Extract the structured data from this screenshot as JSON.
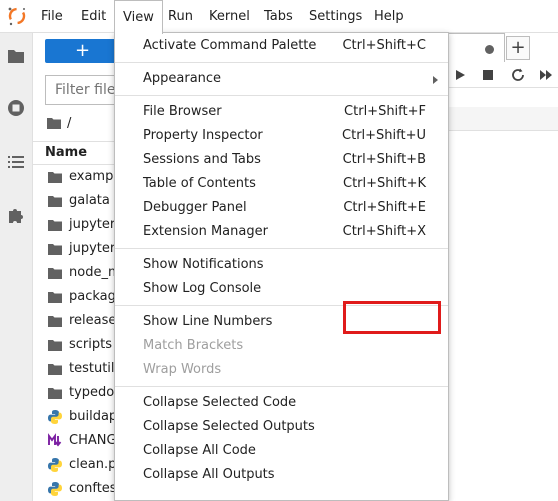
{
  "menubar": {
    "items": [
      "File",
      "Edit",
      "View",
      "Run",
      "Kernel",
      "Tabs",
      "Settings",
      "Help"
    ],
    "active": "View"
  },
  "filebrowser": {
    "new_button_label": "+",
    "filter_placeholder": "Filter files",
    "breadcrumb": "/",
    "column_name": "Name",
    "files": [
      {
        "name": "examples",
        "icon": "folder-icon"
      },
      {
        "name": "galata",
        "icon": "folder-icon"
      },
      {
        "name": "jupyter-",
        "icon": "folder-icon"
      },
      {
        "name": "jupyterl",
        "icon": "folder-icon"
      },
      {
        "name": "node_m",
        "icon": "folder-icon"
      },
      {
        "name": "package",
        "icon": "folder-icon"
      },
      {
        "name": "release",
        "icon": "folder-icon"
      },
      {
        "name": "scripts",
        "icon": "folder-icon"
      },
      {
        "name": "testutils",
        "icon": "folder-icon"
      },
      {
        "name": "typedoc",
        "icon": "folder-icon"
      },
      {
        "name": "buildap",
        "icon": "python-icon"
      },
      {
        "name": "CHANG",
        "icon": "markdown-icon"
      },
      {
        "name": "clean.py",
        "icon": "python-icon"
      },
      {
        "name": "conftest",
        "icon": "python-icon"
      }
    ]
  },
  "view_menu": {
    "group1": [
      {
        "label": "Activate Command Palette",
        "shortcut": "Ctrl+Shift+C"
      }
    ],
    "group2": [
      {
        "label": "Appearance",
        "submenu": true
      }
    ],
    "group3": [
      {
        "label": "File Browser",
        "shortcut": "Ctrl+Shift+F"
      },
      {
        "label": "Property Inspector",
        "shortcut": "Ctrl+Shift+U"
      },
      {
        "label": "Sessions and Tabs",
        "shortcut": "Ctrl+Shift+B"
      },
      {
        "label": "Table of Contents",
        "shortcut": "Ctrl+Shift+K"
      },
      {
        "label": "Debugger Panel",
        "shortcut": "Ctrl+Shift+E"
      },
      {
        "label": "Extension Manager",
        "shortcut": "Ctrl+Shift+X"
      }
    ],
    "group4": [
      {
        "label": "Show Notifications"
      },
      {
        "label": "Show Log Console"
      }
    ],
    "group5": [
      {
        "label": "Show Line Numbers"
      },
      {
        "label": "Match Brackets",
        "disabled": true
      },
      {
        "label": "Wrap Words",
        "disabled": true
      }
    ],
    "group6": [
      {
        "label": "Collapse Selected Code"
      },
      {
        "label": "Collapse Selected Outputs"
      },
      {
        "label": "Collapse All Code"
      },
      {
        "label": "Collapse All Outputs"
      }
    ]
  },
  "colors": {
    "accent": "#1976d2",
    "highlight": "#e01b1b",
    "logo_orange": "#f37726"
  }
}
